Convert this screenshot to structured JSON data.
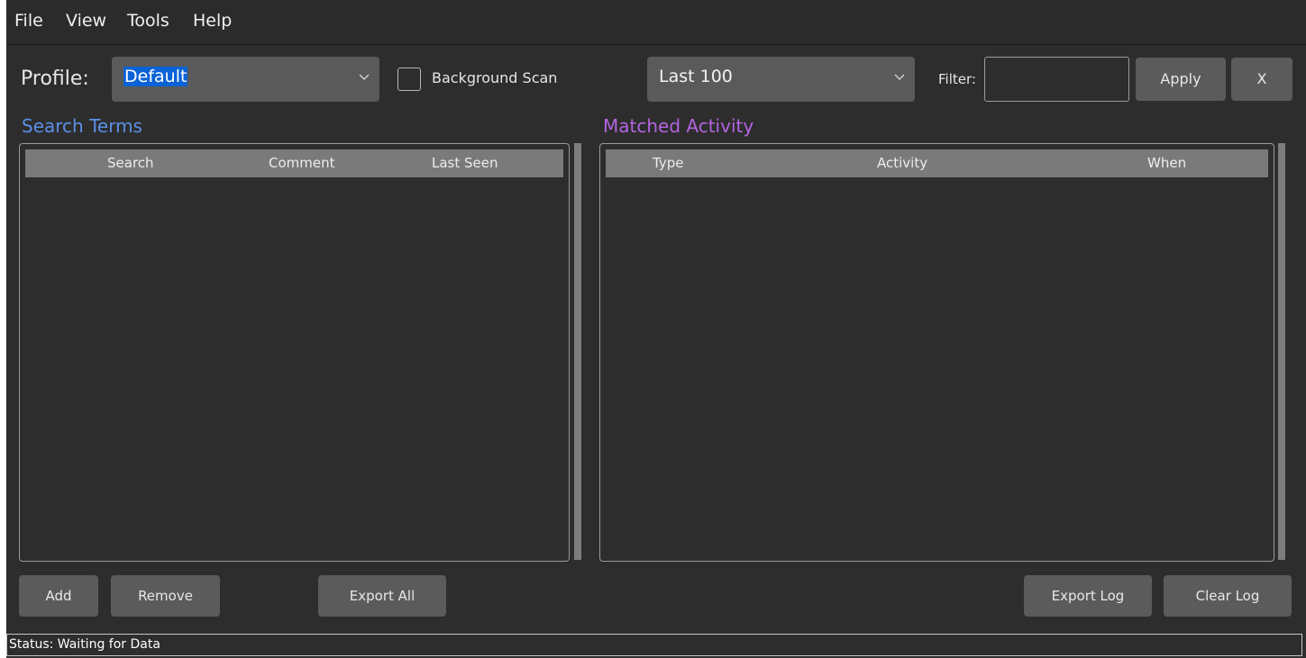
{
  "menu": {
    "items": [
      "File",
      "View",
      "Tools",
      "Help"
    ]
  },
  "toolbar": {
    "profile_label": "Profile:",
    "profile_value": "Default",
    "background_scan_label": "Background Scan",
    "background_scan_checked": false,
    "range_value": "Last 100",
    "filter_label": "Filter:",
    "filter_value": "",
    "apply_label": "Apply",
    "clear_label": "X"
  },
  "search_terms": {
    "title": "Search Terms",
    "columns": [
      "Search",
      "Comment",
      "Last Seen"
    ],
    "rows": []
  },
  "matched_activity": {
    "title": "Matched Activity",
    "columns": [
      "Type",
      "Activity",
      "When"
    ],
    "rows": []
  },
  "actions": {
    "add_label": "Add",
    "remove_label": "Remove",
    "export_all_label": "Export All",
    "export_log_label": "Export Log",
    "clear_log_label": "Clear Log"
  },
  "status": {
    "text": "Status: Waiting for Data"
  },
  "colors": {
    "search_terms_title": "#5b8fe8",
    "matched_activity_title": "#b264e0",
    "selection": "#0a62d6"
  }
}
